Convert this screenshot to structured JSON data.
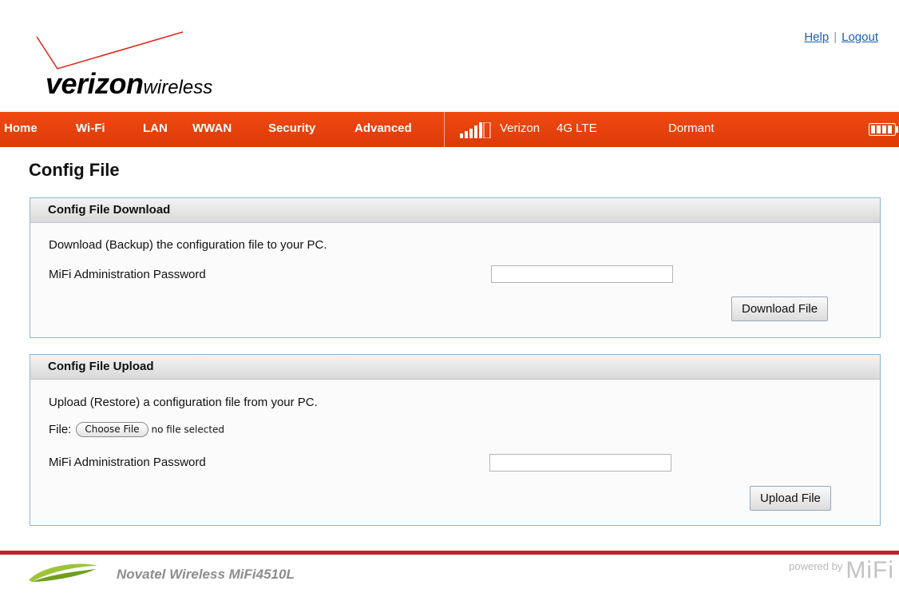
{
  "header": {
    "brand_main": "verizon",
    "brand_sub": "wireless",
    "links": {
      "help": "Help",
      "separator": "|",
      "logout": "Logout"
    }
  },
  "nav": {
    "items": [
      "Home",
      "Wi-Fi",
      "LAN",
      "WWAN",
      "Security",
      "Advanced"
    ],
    "network": "Verizon",
    "technology": "4G LTE",
    "status": "Dormant",
    "icons": {
      "signal": "signal-bars-icon",
      "battery": "battery-icon"
    }
  },
  "page": {
    "title": "Config File"
  },
  "download_panel": {
    "title": "Config File Download",
    "description": "Download (Backup) the configuration file to your PC.",
    "password_label": "MiFi Administration Password",
    "password_value": "",
    "button": "Download File"
  },
  "upload_panel": {
    "title": "Config File Upload",
    "description": "Upload (Restore) a configuration file from your PC.",
    "file_label": "File:",
    "choose_button": "Choose File",
    "file_status": "no file selected",
    "password_label": "MiFi Administration Password",
    "password_value": "",
    "button": "Upload File"
  },
  "footer": {
    "model": "Novatel Wireless MiFi4510L",
    "powered_by": "powered by",
    "powered_brand": "MiFi"
  },
  "colors": {
    "nav_bar": "#e8420e",
    "footer_line": "#c6202a",
    "panel_border": "#8fb6d4",
    "link": "#1a5fb4"
  }
}
